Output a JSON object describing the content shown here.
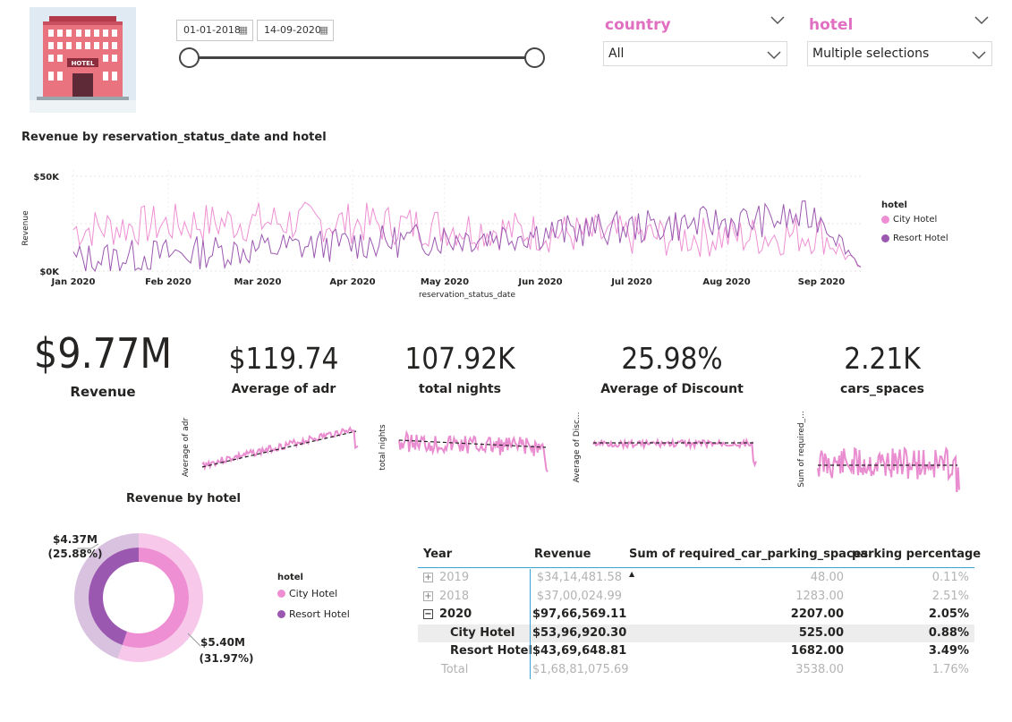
{
  "date_slicer": {
    "start": "01-01-2018",
    "end": "14-09-2020",
    "icon": "calendar-icon"
  },
  "country_slicer": {
    "title": "country",
    "value": "All"
  },
  "hotel_slicer": {
    "title": "hotel",
    "value": "Multiple selections"
  },
  "colors": {
    "accent": "#e06ec1",
    "city_hotel": "#ee8fd3",
    "resort_hotel": "#9b58b0",
    "city_light": "#f7c8ea",
    "resort_light": "#d9c2df"
  },
  "line_chart": {
    "title": "Revenue by reservation_status_date and hotel",
    "ylabel": "Revenue",
    "xlabel": "reservation_status_date",
    "yticks": [
      "$50K",
      "$0K"
    ],
    "xticks": [
      "Jan 2020",
      "Feb 2020",
      "Mar 2020",
      "Apr 2020",
      "May 2020",
      "Jun 2020",
      "Jul 2020",
      "Aug 2020",
      "Sep 2020"
    ],
    "legend_title": "hotel",
    "legend": [
      "City Hotel",
      "Resort Hotel"
    ]
  },
  "kpis": [
    {
      "value": "$9.77M",
      "label": "Revenue"
    },
    {
      "value": "$119.74",
      "label": "Average of adr",
      "spark_ylabel": "Average of adr"
    },
    {
      "value": "107.92K",
      "label": "total nights",
      "spark_ylabel": "total nights"
    },
    {
      "value": "25.98%",
      "label": "Average of Discount",
      "spark_ylabel": "Average of Disc..."
    },
    {
      "value": "2.21K",
      "label": "cars_spaces",
      "spark_ylabel": "Sum of required_..."
    }
  ],
  "donut": {
    "title": "Revenue by hotel",
    "legend_title": "hotel",
    "legend": [
      "City Hotel",
      "Resort Hotel"
    ],
    "slices": [
      {
        "name": "City Hotel",
        "value": 5.4,
        "label": "$5.40M",
        "pct": "(31.97%)"
      },
      {
        "name": "Resort Hotel",
        "value": 4.37,
        "label": "$4.37M",
        "pct": "(25.88%)"
      }
    ]
  },
  "table": {
    "headers": [
      "Year",
      "Revenue",
      "Sum of required_car_parking_spaces",
      "parking percentage"
    ],
    "rows": [
      {
        "year": "2019",
        "expander": "+",
        "revenue": "$34,14,481.58",
        "parking": "48.00",
        "pct": "0.11%",
        "style": "muted"
      },
      {
        "year": "2018",
        "expander": "+",
        "revenue": "$37,00,024.99",
        "parking": "1283.00",
        "pct": "2.51%",
        "style": "muted"
      },
      {
        "year": "2020",
        "expander": "−",
        "revenue": "$97,66,569.11",
        "parking": "2207.00",
        "pct": "2.05%",
        "style": "bold"
      },
      {
        "year": "City Hotel",
        "expander": "",
        "revenue": "$53,96,920.30",
        "parking": "525.00",
        "pct": "0.88%",
        "style": "child"
      },
      {
        "year": "Resort Hotel",
        "expander": "",
        "revenue": "$43,69,648.81",
        "parking": "1682.00",
        "pct": "3.49%",
        "style": "child"
      },
      {
        "year": "Total",
        "expander": "",
        "revenue": "$1,68,81,075.69",
        "parking": "3538.00",
        "pct": "1.76%",
        "style": "total"
      }
    ]
  }
}
